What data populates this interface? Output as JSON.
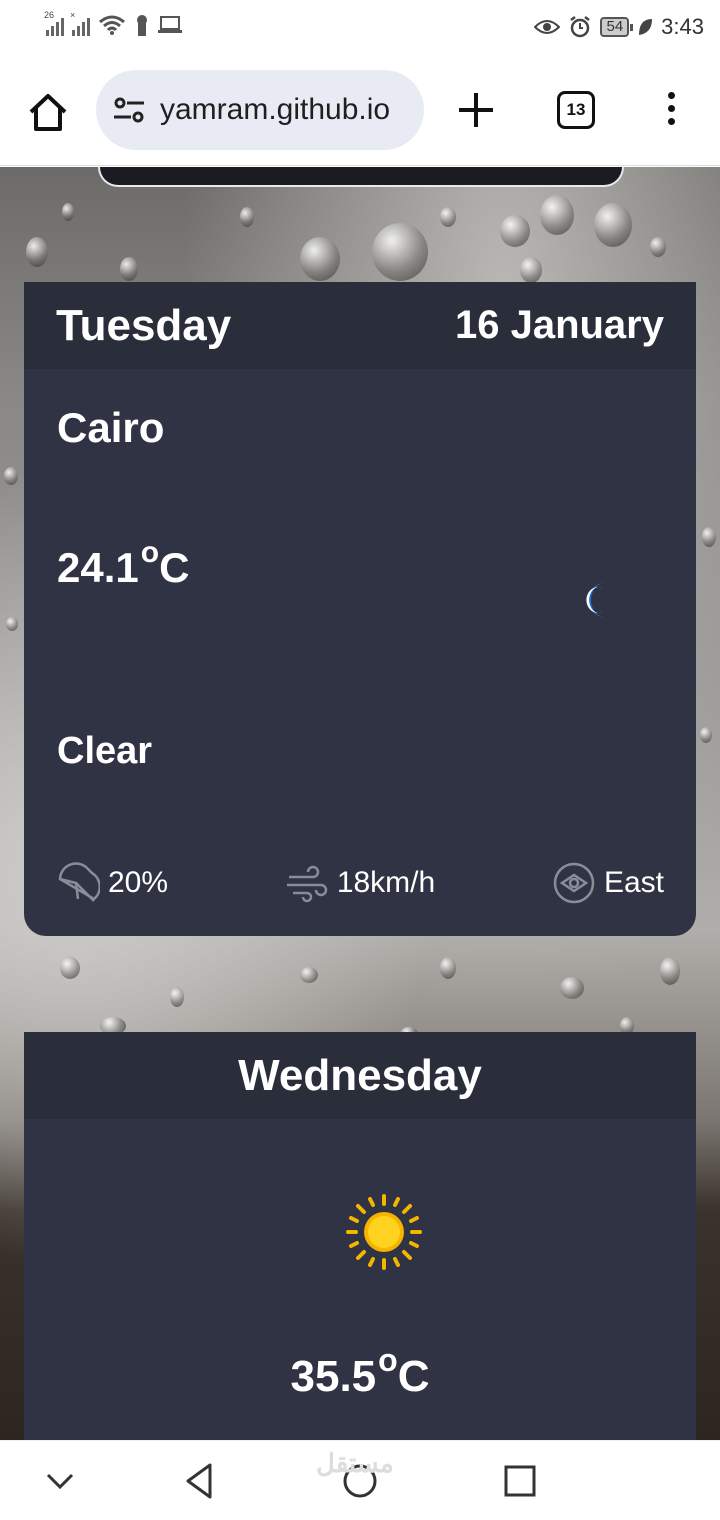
{
  "status_bar": {
    "network1_tag": "26",
    "network2_tag": "×",
    "battery_level": "54",
    "time": "3:43"
  },
  "browser": {
    "url": "yamram.github.io",
    "tab_count": "13"
  },
  "today": {
    "day": "Tuesday",
    "date": "16 January",
    "city": "Cairo",
    "temperature": "24.1",
    "degree_symbol": "o",
    "unit": "C",
    "condition": "Clear",
    "condition_icon": "moon-icon",
    "humidity": "20%",
    "wind_speed": "18km/h",
    "wind_direction": "East"
  },
  "tomorrow": {
    "day": "Wednesday",
    "temperature": "35.5",
    "degree_symbol": "o",
    "unit": "C",
    "condition_icon": "sun-icon"
  },
  "watermark": "مستقل",
  "colors": {
    "card_bg": "#303343",
    "card_header_bg": "#2a2d3a",
    "moon": "#1e6fd9",
    "sun": "#f5b400"
  }
}
